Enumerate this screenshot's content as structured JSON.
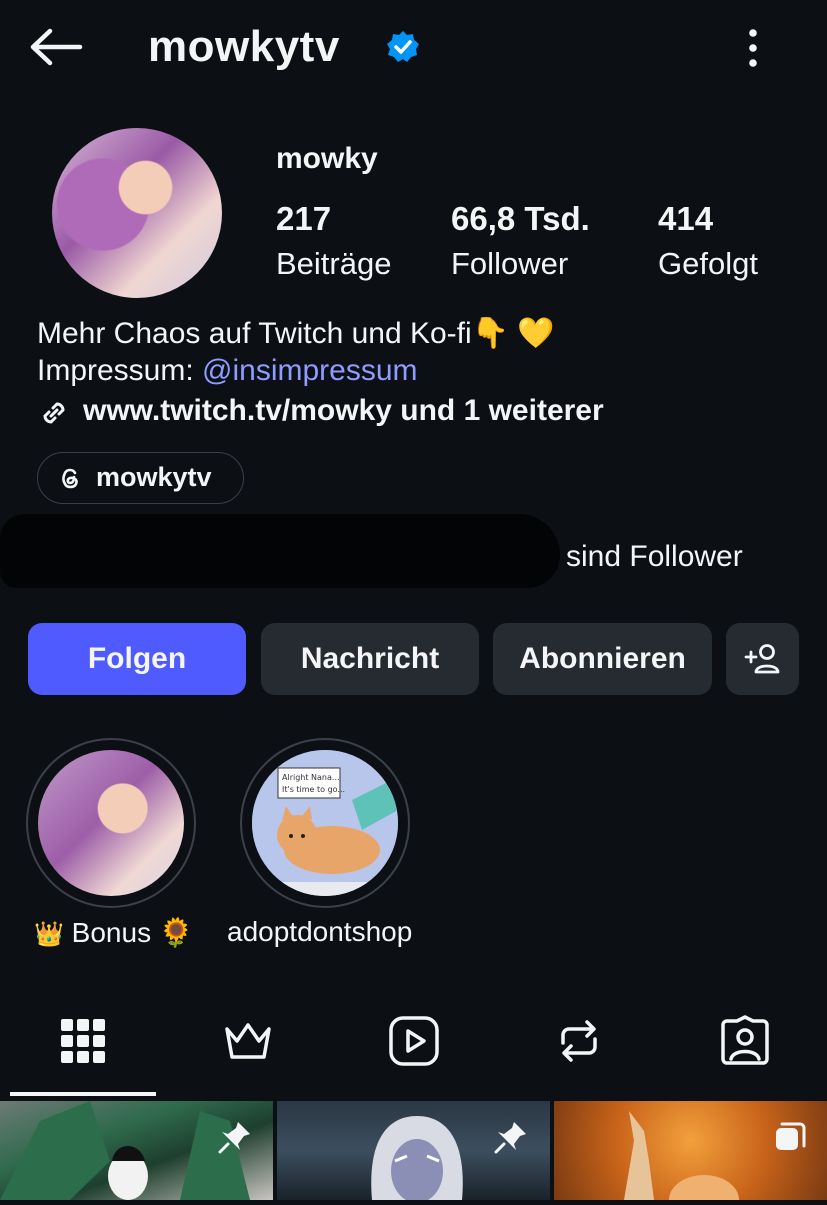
{
  "header": {
    "username": "mowkytv",
    "back_icon": "arrow-left-icon",
    "verified_icon": "verified-badge-icon",
    "verified_color": "#0095f6",
    "more_icon": "more-vertical-icon"
  },
  "profile": {
    "display_name": "mowky",
    "stats": [
      {
        "value": "217",
        "label": "Beiträge"
      },
      {
        "value": "66,8 Tsd.",
        "label": "Follower"
      },
      {
        "value": "414",
        "label": "Gefolgt"
      }
    ],
    "bio_line1": "Mehr Chaos auf Twitch und Ko-fi👇 💛",
    "impressum_label": "Impressum: ",
    "impressum_mention": "@insimpressum",
    "link": "www.twitch.tv/mowky und 1 weiterer",
    "threads_handle": "mowkytv",
    "followed_by_suffix": "sind Follower"
  },
  "buttons": {
    "follow": "Folgen",
    "message": "Nachricht",
    "subscribe": "Abonnieren",
    "add_person_icon": "add-person-icon",
    "accent": "#4f5bff"
  },
  "highlights": [
    {
      "label": "Bonus 🌻",
      "badge": "👑"
    },
    {
      "label": "adoptdontshop",
      "comic_text": "Alright Nana... It's time to go..."
    }
  ],
  "tabs": [
    "grid-icon",
    "crown-icon",
    "reels-icon",
    "reposts-icon",
    "tagged-icon"
  ]
}
